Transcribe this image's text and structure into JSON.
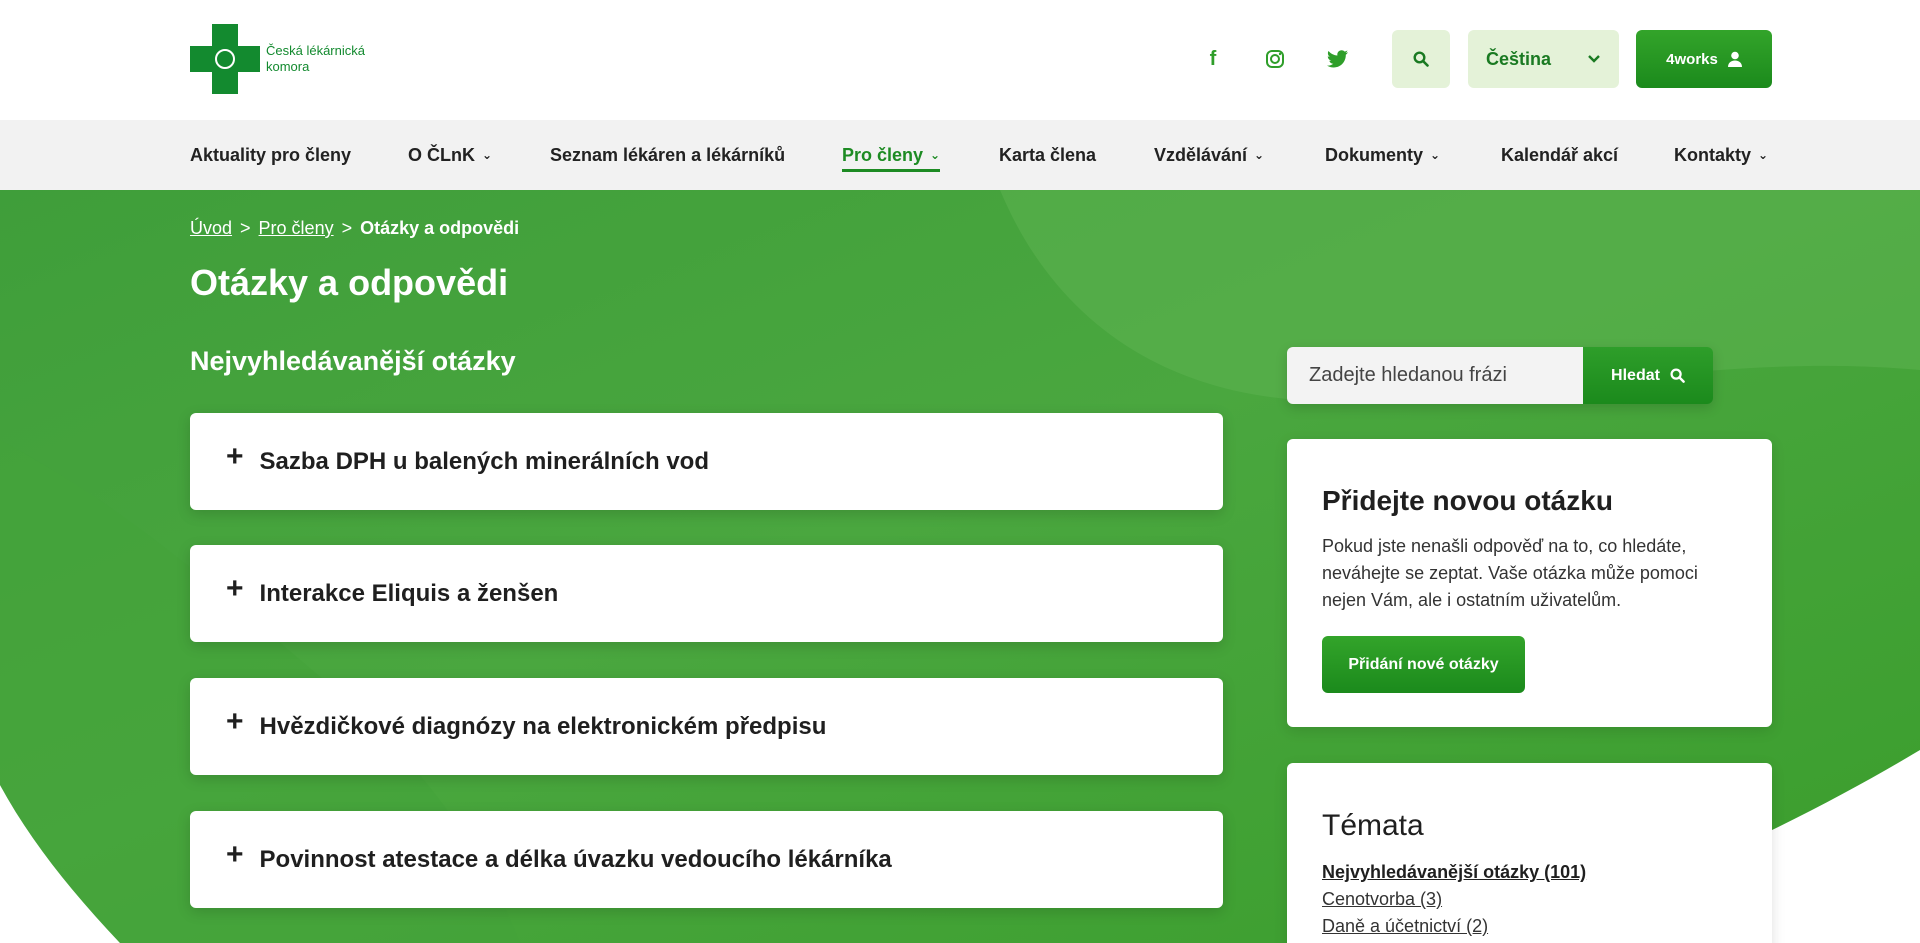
{
  "header": {
    "logo_text": "Česká lékárnická komora",
    "social": [
      {
        "name": "facebook-icon",
        "glyph": "f"
      },
      {
        "name": "instagram-icon",
        "glyph": "◎"
      },
      {
        "name": "twitter-icon",
        "glyph": "🐦"
      }
    ],
    "language": "Čeština",
    "account_label": "4works"
  },
  "nav": {
    "items": [
      {
        "label": "Aktuality pro členy",
        "dropdown": false
      },
      {
        "label": "O ČLnK",
        "dropdown": true
      },
      {
        "label": "Seznam lékáren a lékárníků",
        "dropdown": false
      },
      {
        "label": "Pro členy",
        "dropdown": true,
        "active": true
      },
      {
        "label": "Karta člena",
        "dropdown": false
      },
      {
        "label": "Vzdělávání",
        "dropdown": true
      },
      {
        "label": "Dokumenty",
        "dropdown": true
      },
      {
        "label": "Kalendář akcí",
        "dropdown": false
      },
      {
        "label": "Kontakty",
        "dropdown": true
      }
    ]
  },
  "breadcrumb": {
    "home": "Úvod",
    "parent": "Pro členy",
    "current": "Otázky a odpovědi",
    "separator": ">"
  },
  "page": {
    "title": "Otázky a odpovědi",
    "section_title": "Nejvyhledávanější otázky"
  },
  "questions": [
    "Sazba DPH u balených minerálních vod",
    "Interakce Eliquis a ženšen",
    "Hvězdičkové diagnózy na elektronickém předpisu",
    "Povinnost atestace a délka úvazku vedoucího lékárníka"
  ],
  "search": {
    "placeholder": "Zadejte hledanou frázi",
    "button_label": "Hledat"
  },
  "add_question": {
    "title": "Přidejte novou otázku",
    "text": "Pokud jste nenašli odpověď na to, co hledáte, neváhejte se zeptat. Vaše otázka může pomoci nejen Vám, ale i ostatním uživatelům.",
    "button_label": "Přidání nové otázky"
  },
  "topics": {
    "title": "Témata",
    "items": [
      "Nejvyhledávanější otázky (101)",
      "Cenotvorba (3)",
      "Daně a účetnictví (2)"
    ]
  },
  "colors": {
    "brand_green": "#138a2f",
    "accent_green": "#2f9e2a",
    "hero_green": "#4aaa3c",
    "light_green": "#e4f2d8"
  }
}
